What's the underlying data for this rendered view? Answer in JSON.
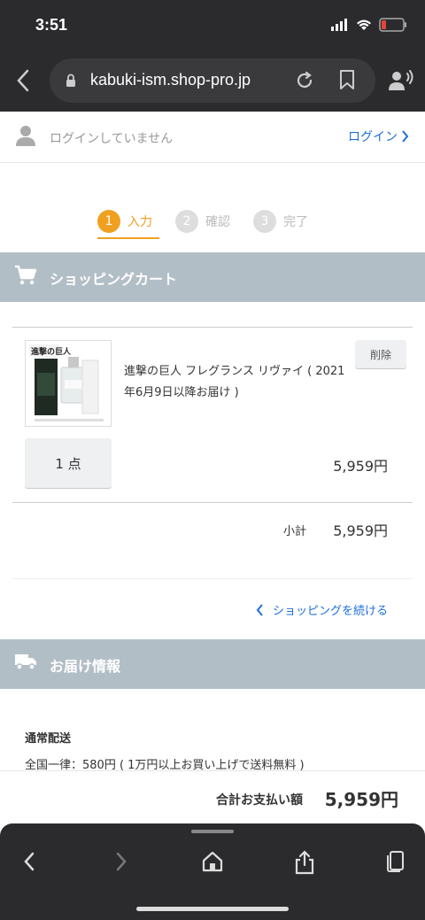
{
  "status_bar": {
    "time": "3:51"
  },
  "browser": {
    "url": "kabuki-ism.shop-pro.jp"
  },
  "login_bar": {
    "status": "ログインしていません",
    "login_label": "ログイン"
  },
  "steps": [
    {
      "num": "1",
      "label": "入力",
      "active": true
    },
    {
      "num": "2",
      "label": "確認",
      "active": false
    },
    {
      "num": "3",
      "label": "完了",
      "active": false
    }
  ],
  "cart": {
    "header": "ショッピングカート",
    "item": {
      "name": "進撃の巨人 フレグランス リヴァイ ( 2021年6月9日以降お届け )",
      "delete_label": "削除",
      "quantity": "1 点",
      "price": "5,959円",
      "thumb_logo": "進撃の巨人"
    },
    "subtotal_label": "小計",
    "subtotal_value": "5,959円",
    "continue_label": "ショッピングを続ける"
  },
  "delivery": {
    "header": "お届け情報",
    "method": "通常配送",
    "description": "全国一律：580円 ( 1万円以上お買い上げで送料無料 )"
  },
  "total": {
    "label": "合計お支払い額",
    "value": "5,959円"
  },
  "colors": {
    "accent": "#f0a020",
    "link": "#1e6fd9",
    "section": "#b2bec6",
    "chrome": "#2b2b2d"
  }
}
